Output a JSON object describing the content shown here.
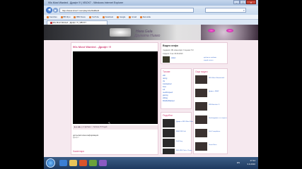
{
  "app_title": "90s Most Wanted - Дрифт !!! | VBOX7 - Windows Internet Explorer",
  "window_controls": {
    "minimize": "–",
    "maximize": "□",
    "close": "✕"
  },
  "navbar": {
    "back": "◀",
    "forward": "▶",
    "url": "http://www.vbox7.com/play:b1e5a90e4f",
    "search_icon": "search-icon"
  },
  "bookmarks": [
    {
      "label": "Favorites"
    },
    {
      "label": "ВВ Игри"
    },
    {
      "label": "BBC News"
    },
    {
      "label": "YouTube"
    },
    {
      "label": "Facebook"
    },
    {
      "label": "Google"
    },
    {
      "label": "Gmail"
    },
    {
      "label": "Zamunda"
    }
  ],
  "tab": {
    "label": "90s Most Wanted - Дрифт !!! | VBOX7"
  },
  "banner": {
    "line1": "Нека Gala",
    "line2": "Другата Нивво"
  },
  "video": {
    "title": "90s Most Wanted - Дрифт !!!",
    "toolbar": "▶ ■ ◀ ▶ ◎ ✉ Добави ☆ Любими ⚑ Подай",
    "info_head": "допълнителна информация",
    "info_text": "Дрифт !"
  },
  "video_info": {
    "heading": "Видео инфо",
    "row1": "гледания: 261   коментари: 0   оценка: 5.0",
    "row2": "сподели: 0   на: 03.09.2010",
    "uploader": "valtek",
    "links": [
      "добави в любими",
      "подай сигнал"
    ]
  },
  "tags": {
    "heading": "Тагове",
    "items": [
      "drift",
      "racing",
      "nfs",
      "mostwanted",
      "bmw",
      "m3",
      "needforspeed",
      "gaming",
      "drifting",
      "90sMostWanted"
    ]
  },
  "related": {
    "heading": "Подобни",
    "items": [
      "Дрифт в NFS Most Wanted",
      "BMW M3 Drift",
      "Drift King",
      "NFS MW Police Chase"
    ]
  },
  "right_col": {
    "heading": "Още видео",
    "items": [
      "NFS Most Wanted drift",
      "Дрифт с BMW",
      "MW Blacklist #1",
      "Необходимост от скорост",
      "Drift Compilation",
      "Street Race"
    ]
  },
  "comments": {
    "heading": "Коментари"
  },
  "taskbar": {
    "language": "EN",
    "time": "17:44",
    "date": "3.9.2010"
  },
  "colors": {
    "accent_pink": "#d44a7d",
    "link_blue": "#3366cc",
    "taskbar": "#1e3a60"
  }
}
